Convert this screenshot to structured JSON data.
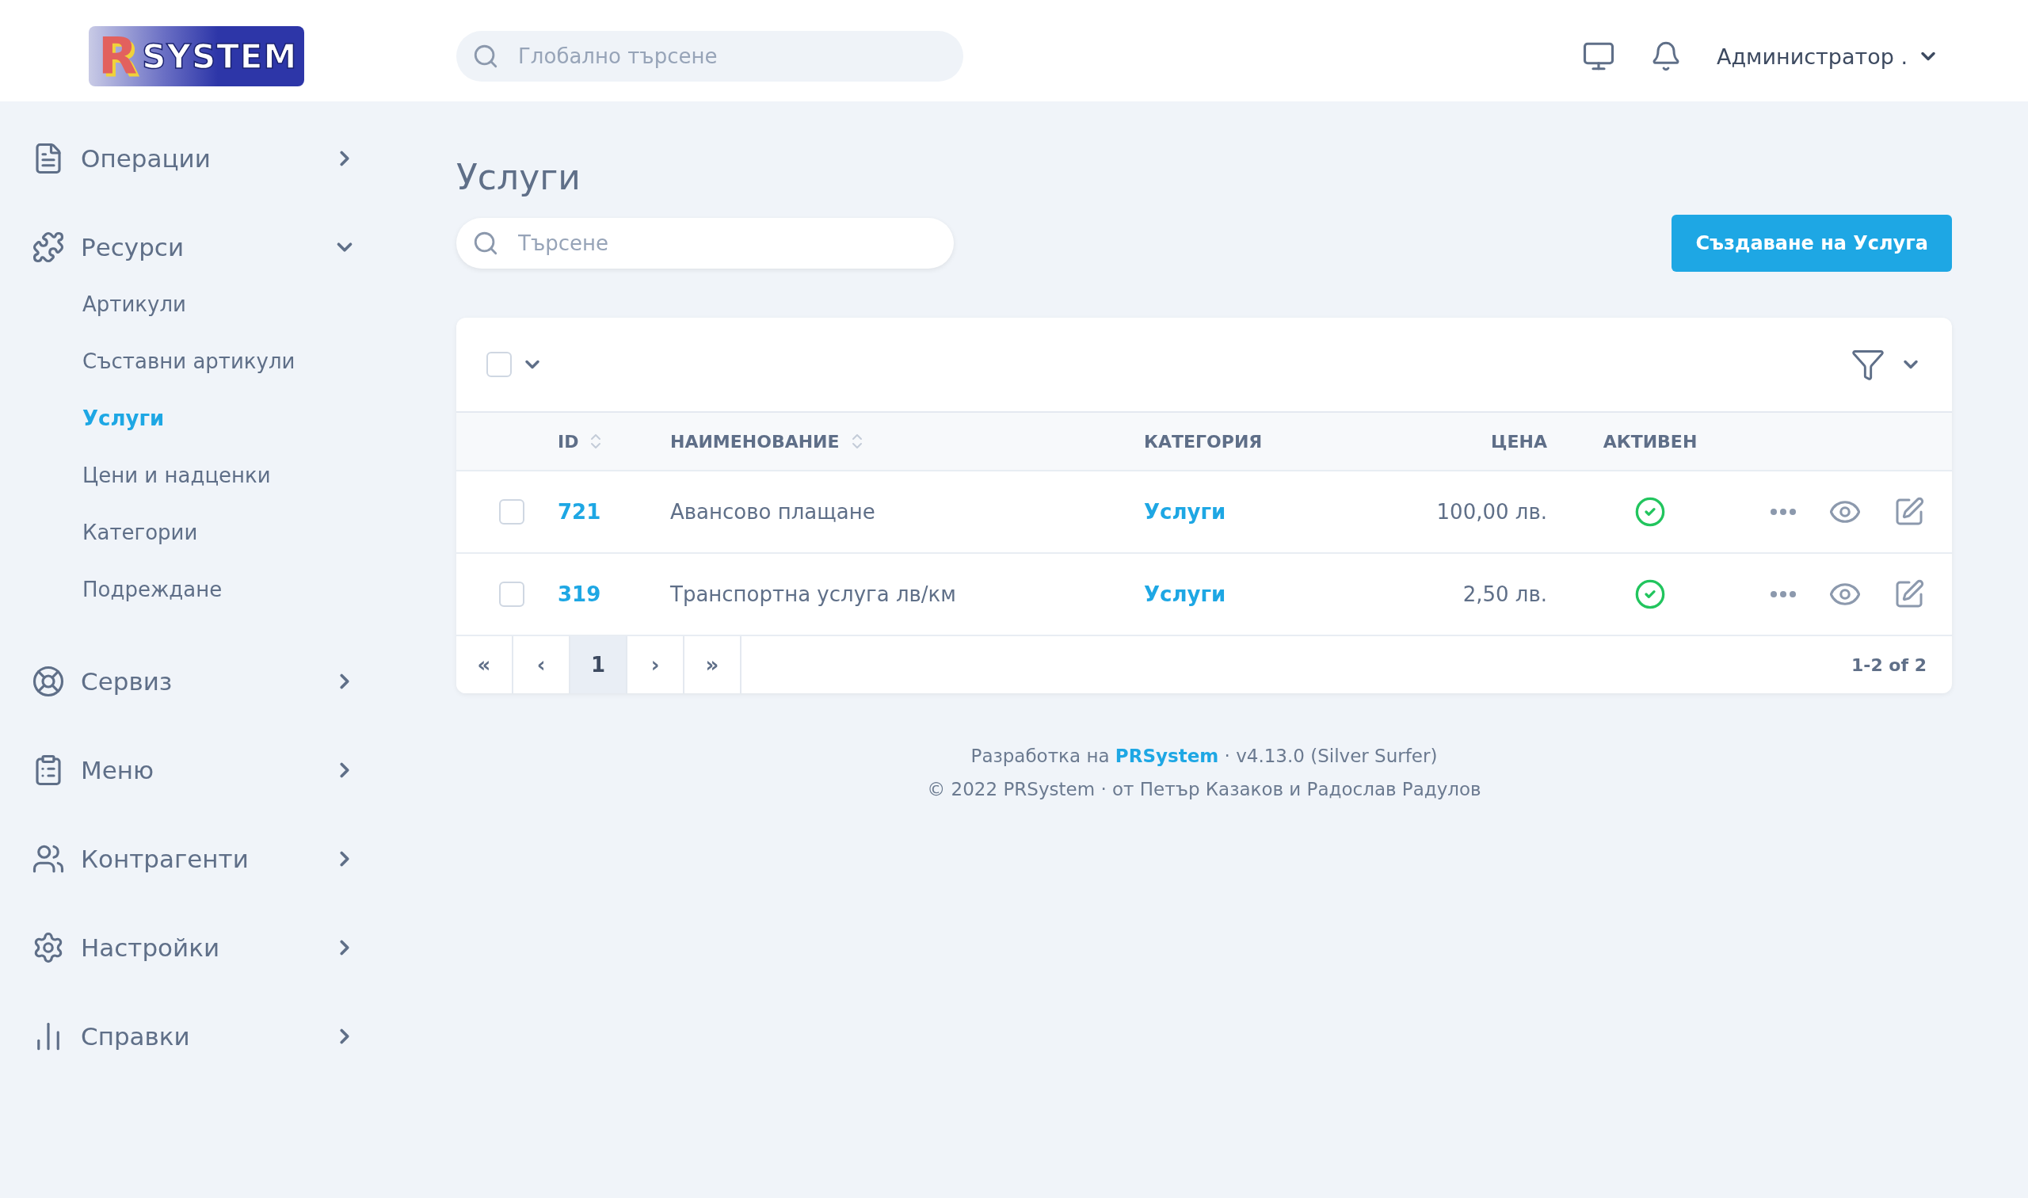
{
  "header": {
    "logo": {
      "mark": "R",
      "text": "SYSTEM"
    },
    "search": {
      "placeholder": "Глобално търсене"
    },
    "user": "Администратор ."
  },
  "sidebar": {
    "items": [
      {
        "label": "Операции",
        "expanded": false
      },
      {
        "label": "Ресурси",
        "expanded": true,
        "children": [
          {
            "label": "Артикули",
            "selected": false
          },
          {
            "label": "Съставни артикули",
            "selected": false
          },
          {
            "label": "Услуги",
            "selected": true
          },
          {
            "label": "Цени и надценки",
            "selected": false
          },
          {
            "label": "Категории",
            "selected": false
          },
          {
            "label": "Подреждане",
            "selected": false
          }
        ]
      },
      {
        "label": "Сервиз",
        "expanded": false
      },
      {
        "label": "Меню",
        "expanded": false
      },
      {
        "label": "Контрагенти",
        "expanded": false
      },
      {
        "label": "Настройки",
        "expanded": false
      },
      {
        "label": "Справки",
        "expanded": false
      }
    ]
  },
  "page": {
    "title": "Услуги",
    "search": {
      "placeholder": "Търсене"
    },
    "create_button": "Създаване на Услуга"
  },
  "table": {
    "select_all": {
      "checked": false
    },
    "columns": [
      {
        "label": "ID",
        "sortable": true
      },
      {
        "label": "НАИМЕНОВАНИЕ",
        "sortable": true
      },
      {
        "label": "КАТЕГОРИЯ",
        "sortable": false
      },
      {
        "label": "ЦЕНА",
        "sortable": false
      },
      {
        "label": "АКТИВЕН",
        "sortable": false
      }
    ],
    "rows": [
      {
        "checked": false,
        "id": "721",
        "name": "Авансово плащане",
        "category": "Услуги",
        "price": "100,00 лв.",
        "active": true
      },
      {
        "checked": false,
        "id": "319",
        "name": "Транспортна услуга лв/км",
        "category": "Услуги",
        "price": "2,50 лв.",
        "active": true
      }
    ],
    "pagination": {
      "buttons": [
        {
          "label": "«",
          "selected": false
        },
        {
          "label": "‹",
          "selected": false
        },
        {
          "label": "1",
          "selected": true
        },
        {
          "label": "›",
          "selected": false
        },
        {
          "label": "»",
          "selected": false
        }
      ],
      "count": "1-2 of 2"
    }
  },
  "footer": {
    "credit": {
      "prefix": "Разработка на",
      "link": "PRSystem",
      "suffix": "· v4.13.0 (Silver Surfer)"
    },
    "copyright": "© 2022 PRSystem · от Петър Казаков и Радослав Радулов"
  }
}
